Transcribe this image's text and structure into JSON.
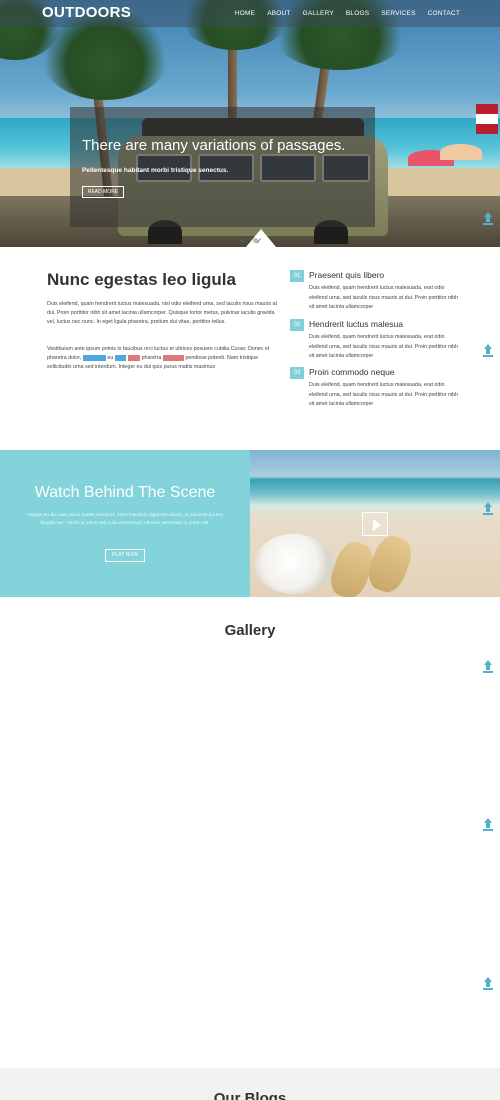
{
  "nav": {
    "logo": "OUTDOORS",
    "items": [
      "HOME",
      "ABOUT",
      "GALLERY",
      "BLOGS",
      "SERVICES",
      "CONTACT"
    ]
  },
  "hero": {
    "title": "There are many variations of passages.",
    "subtitle": "Pellentesque habitant morbi tristique senectus.",
    "button": "READ MORE",
    "slide_count": 2,
    "active_slide": 1
  },
  "intro": {
    "title": "Nunc egestas leo ligula",
    "para1": "Duis eleifend, quam hendrerit luctus malesuada, nisl odio eleifend urna, sed iaculis risus mauris at dui. Proin porttitor nibh sit amet lacinia ullamcorper. Quisque tortor metus, pulvinar iaculis gravida vel, luctus nec nunc. In eget ligula pharetra, pretium dui vitae, porttitor tellus.",
    "para2_a": "Vestibulum ante ipsum primis in faucibus orci luctus et ultrices posuere cubilia Curae; Donec et pharetra dolor, ",
    "para2_b": "commodo",
    "para2_c": " eu ",
    "para2_d": "nunc",
    "para2_e": " ",
    "para2_f": "ligula",
    "para2_g": " pharetra ",
    "para2_h": "pendisse",
    "para2_i": " pendisse potenti. Nam tristique sollicitudin urna sed interdum. Integer eu dui quis purus mattis maximus"
  },
  "features": [
    {
      "num": "01",
      "title": "Praesent quis libero",
      "text": "Duis eleifend, quam hendrerit luctus malesuada, erat odio eleifend urna, sed iaculis risus mauris at dui. Proin porttitor nibh sit amet lacinia ullamcorper"
    },
    {
      "num": "02",
      "title": "Hendrerit luctus malesua",
      "text": "Duis eleifend, quam hendrerit luctus malesuada, erat odio eleifend urna, sed iaculis risus mauris at dui. Proin porttitor nibh sit amet lacinia ullamcorper"
    },
    {
      "num": "03",
      "title": "Proin commodo neque",
      "text": "Duis eleifend, quam hendrerit luctus malesuada, erat odio eleifend urna, sed iaculis risus mauris at dui. Proin porttitor nibh sit amet lacinia ullamcorper"
    }
  ],
  "watch": {
    "title": "Watch Behind The Scene",
    "text": "Integer eu dui quis purus mattis maximus. Nam interdum dignissim libero, at placerat dui leo fringilla nec. Morbi ac risus sed nulla elementum ultricies venenatis in tortor nisl.",
    "button": "PLAY NOW",
    "video_icon": "play-icon"
  },
  "gallery": {
    "title": "Gallery"
  },
  "blogs": {
    "title": "Our Blogs"
  },
  "colors": {
    "accent": "#82d3da",
    "number_badge": "#82cfd9",
    "arrow": "#4fb2c8"
  },
  "side_icon": "scroll-up-icon"
}
